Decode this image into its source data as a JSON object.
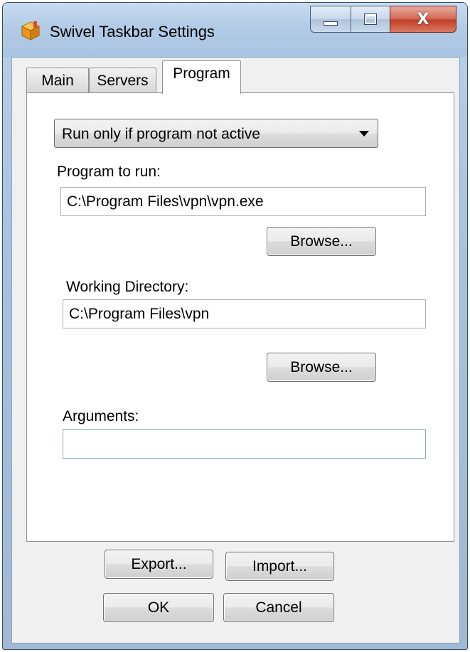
{
  "window": {
    "title": "Swivel Taskbar Settings",
    "app_icon": "swivel-app-icon",
    "caption_buttons": {
      "minimize_icon": "minimize-icon",
      "maximize_icon": "maximize-icon",
      "close_icon": "close-icon",
      "close_glyph": "X"
    }
  },
  "tabs": [
    {
      "label": "Main",
      "active": false
    },
    {
      "label": "Servers",
      "active": false
    },
    {
      "label": "Program",
      "active": true
    }
  ],
  "program_panel": {
    "run_mode_select": {
      "selected": "Run only if program not active"
    },
    "program_to_run": {
      "label": "Program to run:",
      "value": "C:\\Program Files\\vpn\\vpn.exe",
      "browse_label": "Browse..."
    },
    "working_directory": {
      "label": "Working Directory:",
      "value": "C:\\Program Files\\vpn",
      "browse_label": "Browse..."
    },
    "arguments": {
      "label": "Arguments:",
      "value": ""
    }
  },
  "footer": {
    "export_label": "Export...",
    "import_label": "Import...",
    "ok_label": "OK",
    "cancel_label": "Cancel"
  },
  "colors": {
    "window_frame": "#a9c4e2",
    "close_button": "#c1402a",
    "client_background": "#f0f0f0",
    "panel_background": "#ffffff"
  }
}
